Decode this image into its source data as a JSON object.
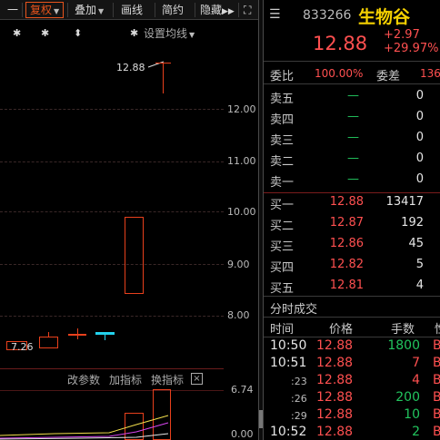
{
  "toolbar": {
    "items": [
      {
        "label": "一"
      },
      {
        "label": "复权"
      },
      {
        "label": "叠加"
      },
      {
        "label": "画线"
      },
      {
        "label": "简约"
      },
      {
        "label": "隐藏"
      },
      {
        "label": "⛶"
      }
    ],
    "settings_label": "设置均线"
  },
  "chart": {
    "markers": [
      "✱",
      "✱",
      "⬍",
      "✱"
    ],
    "y_ticks": [
      "12.00",
      "11.00",
      "10.00",
      "9.00",
      "8.00"
    ],
    "high_label": "12.88",
    "low_label": "7.26",
    "sub_panel": {
      "buttons": [
        "改参数",
        "加指标",
        "换指标"
      ],
      "close_label": "×",
      "y_ticks": [
        "6.74",
        "0.00"
      ]
    }
  },
  "quote": {
    "code": "833266",
    "name": "生物谷",
    "price": "12.88",
    "change": "+2.97",
    "change_pct": "+29.97%",
    "ratio_label": "委比",
    "ratio_value": "100.00%",
    "diff_label": "委差",
    "diff_value": "136",
    "sells": [
      {
        "label": "卖五",
        "price": "—",
        "volume": "0"
      },
      {
        "label": "卖四",
        "price": "—",
        "volume": "0"
      },
      {
        "label": "卖三",
        "price": "—",
        "volume": "0"
      },
      {
        "label": "卖二",
        "price": "—",
        "volume": "0"
      },
      {
        "label": "卖一",
        "price": "—",
        "volume": "0"
      }
    ],
    "buys": [
      {
        "label": "买一",
        "price": "12.88",
        "volume": "13417"
      },
      {
        "label": "买二",
        "price": "12.87",
        "volume": "192"
      },
      {
        "label": "买三",
        "price": "12.86",
        "volume": "45"
      },
      {
        "label": "买四",
        "price": "12.82",
        "volume": "5"
      },
      {
        "label": "买五",
        "price": "12.81",
        "volume": "4"
      }
    ]
  },
  "time_sales": {
    "title": "分时成交",
    "headers": {
      "time": "时间",
      "price": "价格",
      "volume": "手数",
      "flag": "性"
    },
    "rows": [
      {
        "time": "10:50",
        "price": "12.88",
        "volume": "1800",
        "flag": "B"
      },
      {
        "time": "10:51",
        "price": "12.88",
        "volume": "7",
        "flag": "B"
      },
      {
        "time": ":23",
        "price": "12.88",
        "volume": "4",
        "flag": "B"
      },
      {
        "time": ":26",
        "price": "12.88",
        "volume": "200",
        "flag": "B"
      },
      {
        "time": ":29",
        "price": "12.88",
        "volume": "10",
        "flag": "B"
      },
      {
        "time": "10:52",
        "price": "12.88",
        "volume": "2",
        "flag": "B"
      }
    ]
  },
  "colors": {
    "up": "#ff5050",
    "down": "#22c55e",
    "name": "#f4d000",
    "accent": "#e8541c"
  }
}
